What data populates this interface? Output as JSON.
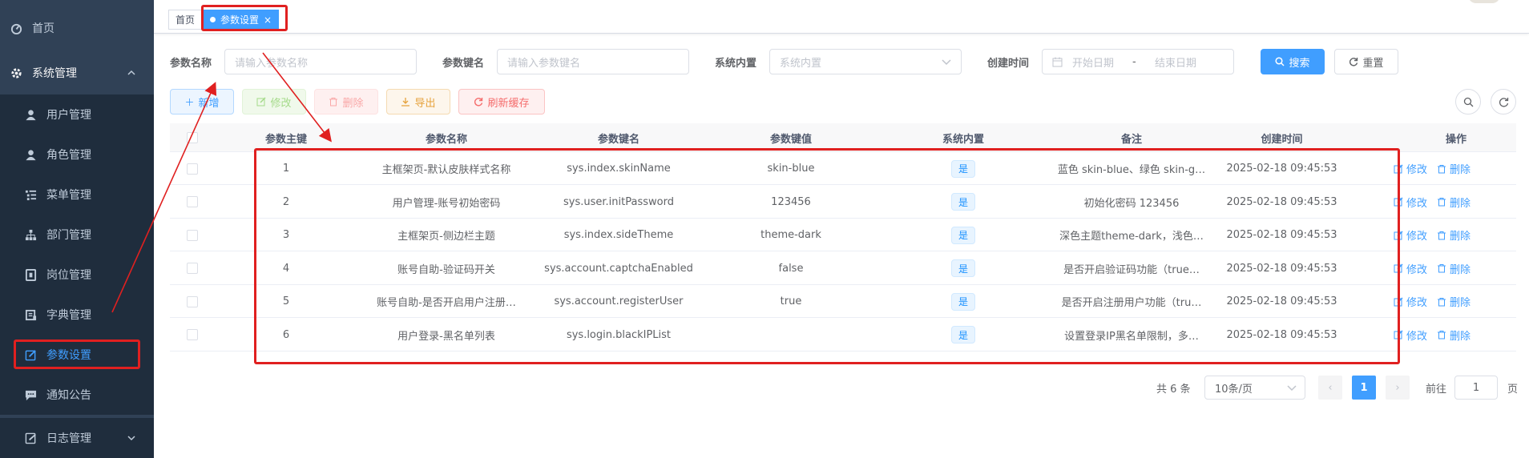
{
  "sidebar": {
    "items": [
      {
        "label": "首页",
        "icon": "dashboard-icon"
      },
      {
        "label": "系统管理",
        "icon": "gear-icon"
      },
      {
        "label": "用户管理",
        "icon": "user-icon"
      },
      {
        "label": "角色管理",
        "icon": "peoples-icon"
      },
      {
        "label": "菜单管理",
        "icon": "tree-table-icon"
      },
      {
        "label": "部门管理",
        "icon": "tree-icon"
      },
      {
        "label": "岗位管理",
        "icon": "post-icon"
      },
      {
        "label": "字典管理",
        "icon": "dict-icon"
      },
      {
        "label": "参数设置",
        "icon": "edit-icon"
      },
      {
        "label": "通知公告",
        "icon": "message-icon"
      },
      {
        "label": "日志管理",
        "icon": "log-icon"
      }
    ]
  },
  "tags": {
    "home": "首页",
    "current": "参数设置",
    "close": "×"
  },
  "search": {
    "config_name_label": "参数名称",
    "config_name_placeholder": "请输入参数名称",
    "config_key_label": "参数键名",
    "config_key_placeholder": "请输入参数键名",
    "config_type_label": "系统内置",
    "config_type_placeholder": "系统内置",
    "create_time_label": "创建时间",
    "start_placeholder": "开始日期",
    "range_separator": "-",
    "end_placeholder": "结束日期",
    "search_button": "搜索",
    "reset_button": "重置"
  },
  "toolbar": {
    "add": "新增",
    "edit": "修改",
    "delete": "删除",
    "export": "导出",
    "refresh_cache": "刷新缓存"
  },
  "table": {
    "headers": [
      "参数主键",
      "参数名称",
      "参数键名",
      "参数键值",
      "系统内置",
      "备注",
      "创建时间",
      "操作"
    ],
    "rows": [
      {
        "id": "1",
        "name": "主框架页-默认皮肤样式名称",
        "key": "sys.index.skinName",
        "value": "skin-blue",
        "builtin": "是",
        "remark": "蓝色 skin-blue、绿色 skin-g…",
        "time": "2025-02-18 09:45:53"
      },
      {
        "id": "2",
        "name": "用户管理-账号初始密码",
        "key": "sys.user.initPassword",
        "value": "123456",
        "builtin": "是",
        "remark": "初始化密码 123456",
        "time": "2025-02-18 09:45:53"
      },
      {
        "id": "3",
        "name": "主框架页-侧边栏主题",
        "key": "sys.index.sideTheme",
        "value": "theme-dark",
        "builtin": "是",
        "remark": "深色主题theme-dark，浅色…",
        "time": "2025-02-18 09:45:53"
      },
      {
        "id": "4",
        "name": "账号自助-验证码开关",
        "key": "sys.account.captchaEnabled",
        "value": "false",
        "builtin": "是",
        "remark": "是否开启验证码功能（true…",
        "time": "2025-02-18 09:45:53"
      },
      {
        "id": "5",
        "name": "账号自助-是否开启用户注册…",
        "key": "sys.account.registerUser",
        "value": "true",
        "builtin": "是",
        "remark": "是否开启注册用户功能（tru…",
        "time": "2025-02-18 09:45:53"
      },
      {
        "id": "6",
        "name": "用户登录-黑名单列表",
        "key": "sys.login.blackIPList",
        "value": "",
        "builtin": "是",
        "remark": "设置登录IP黑名单限制，多…",
        "time": "2025-02-18 09:45:53"
      }
    ],
    "op_edit": "修改",
    "op_delete": "删除"
  },
  "pagination": {
    "total": "共 6 条",
    "page_size": "10条/页",
    "current_page": "1",
    "goto_label": "前往",
    "goto_value": "1",
    "page_suffix": "页"
  },
  "colors": {
    "sidebar_bg": "#304156",
    "primary": "#409eff",
    "annotation_red": "#e02020"
  }
}
